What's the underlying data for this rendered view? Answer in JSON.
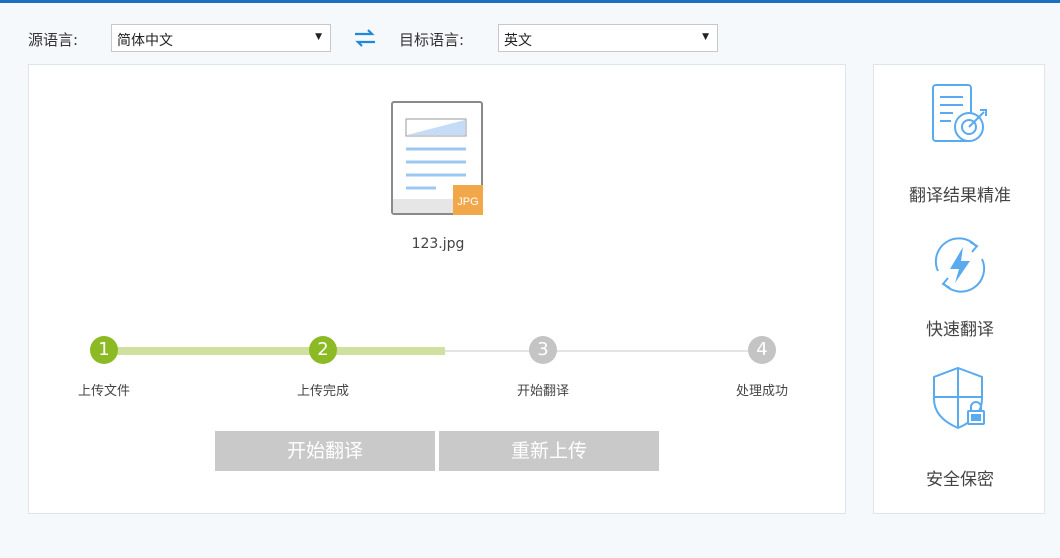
{
  "toolbar": {
    "source_label": "源语言:",
    "source_value": "简体中文",
    "target_label": "目标语言:",
    "target_value": "英文",
    "dropdown_arrow": "▼"
  },
  "upload": {
    "file_badge": "JPG",
    "file_name": "123.jpg"
  },
  "steps": [
    {
      "number": "1",
      "label": "上传文件",
      "status": "done"
    },
    {
      "number": "2",
      "label": "上传完成",
      "status": "done"
    },
    {
      "number": "3",
      "label": "开始翻译",
      "status": "pending"
    },
    {
      "number": "4",
      "label": "处理成功",
      "status": "pending"
    }
  ],
  "progress": 0.5,
  "buttons": {
    "start": "开始翻译",
    "reupload": "重新上传"
  },
  "features": [
    {
      "icon": "target-document-icon",
      "label": "翻译结果精准"
    },
    {
      "icon": "lightning-refresh-icon",
      "label": "快速翻译"
    },
    {
      "icon": "shield-lock-icon",
      "label": "安全保密"
    }
  ],
  "colors": {
    "accent": "#1e6fc4",
    "step_done": "#8cba24",
    "step_pending": "#c4c4c4",
    "icon_blue": "#5aaaf0",
    "badge": "#f2a74b"
  }
}
